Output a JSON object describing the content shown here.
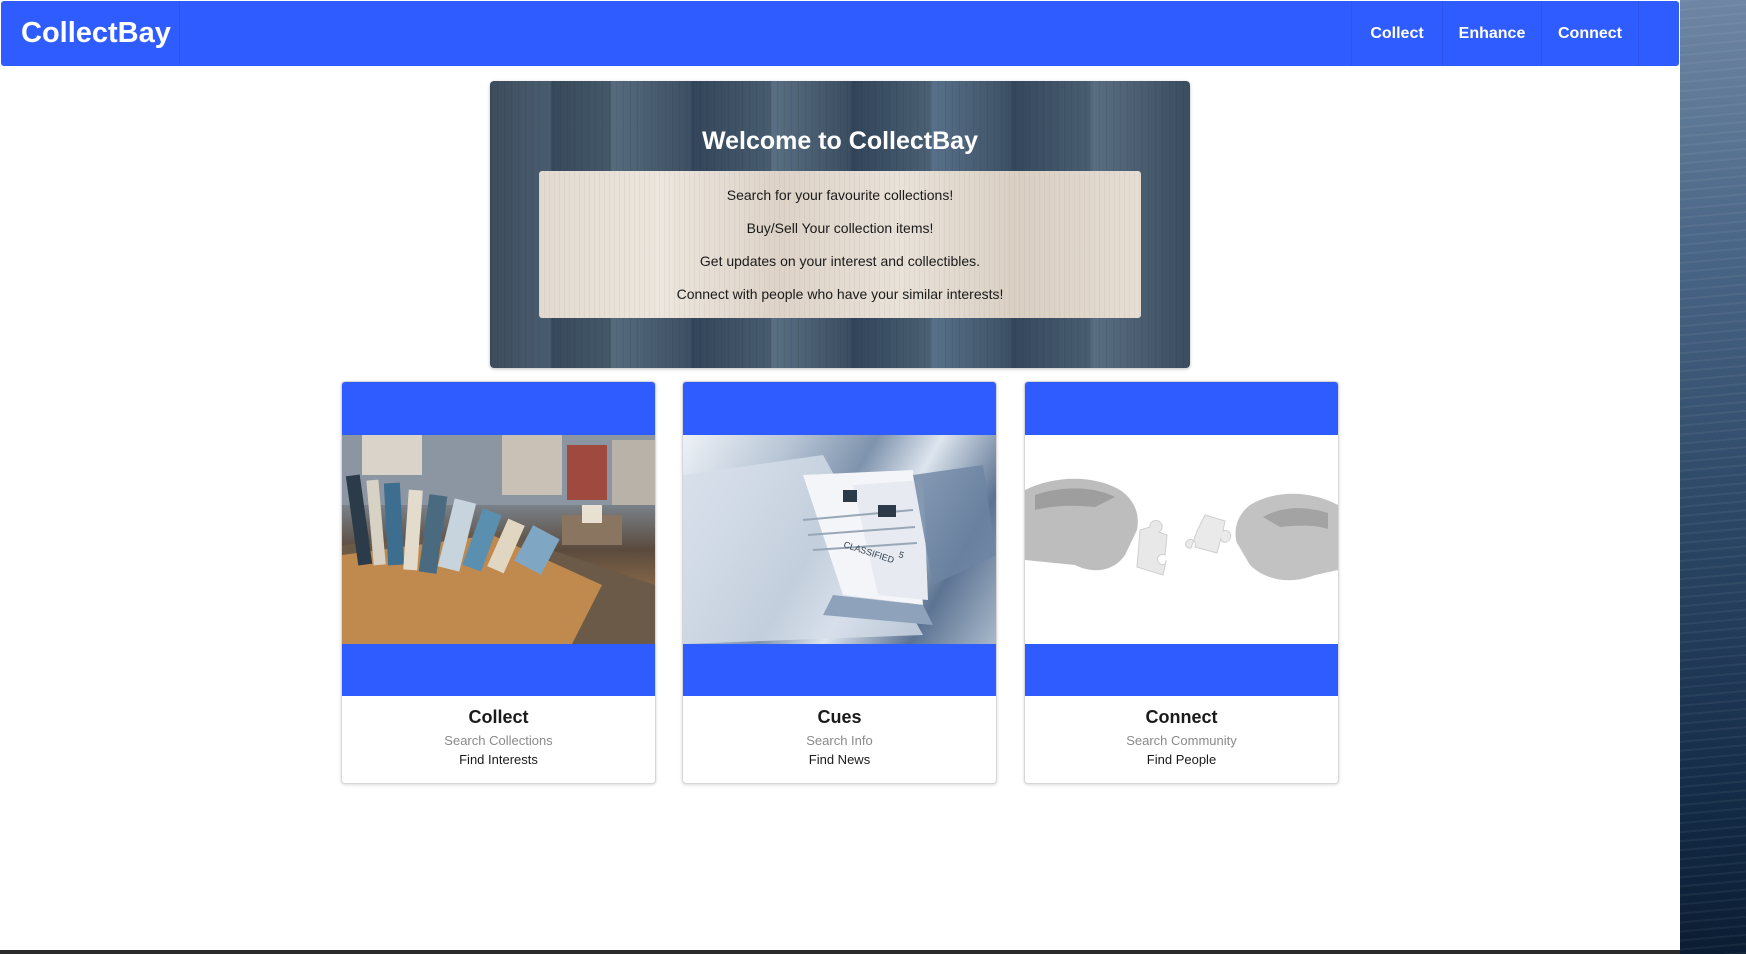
{
  "navbar": {
    "brand": "CollectBay",
    "items": [
      {
        "label": "Collect"
      },
      {
        "label": "Enhance"
      },
      {
        "label": "Connect"
      }
    ]
  },
  "hero": {
    "title": "Welcome to CollectBay",
    "lines": [
      "Search for your favourite collections!",
      "Buy/Sell Your collection items!",
      "Get updates on your interest and collectibles.",
      "Connect with people who have your similar interests!"
    ]
  },
  "cards": [
    {
      "title": "Collect",
      "subtitle": "Search Collections",
      "description": "Find Interests",
      "image": "book-bins-photo"
    },
    {
      "title": "Cues",
      "subtitle": "Search Info",
      "description": "Find News",
      "image": "newspapers-photo"
    },
    {
      "title": "Connect",
      "subtitle": "Search Community",
      "description": "Find People",
      "image": "puzzle-hands-photo"
    }
  ],
  "colors": {
    "accent": "#2f5cff",
    "text": "#1a1a1a",
    "muted": "#8a8a8a"
  }
}
